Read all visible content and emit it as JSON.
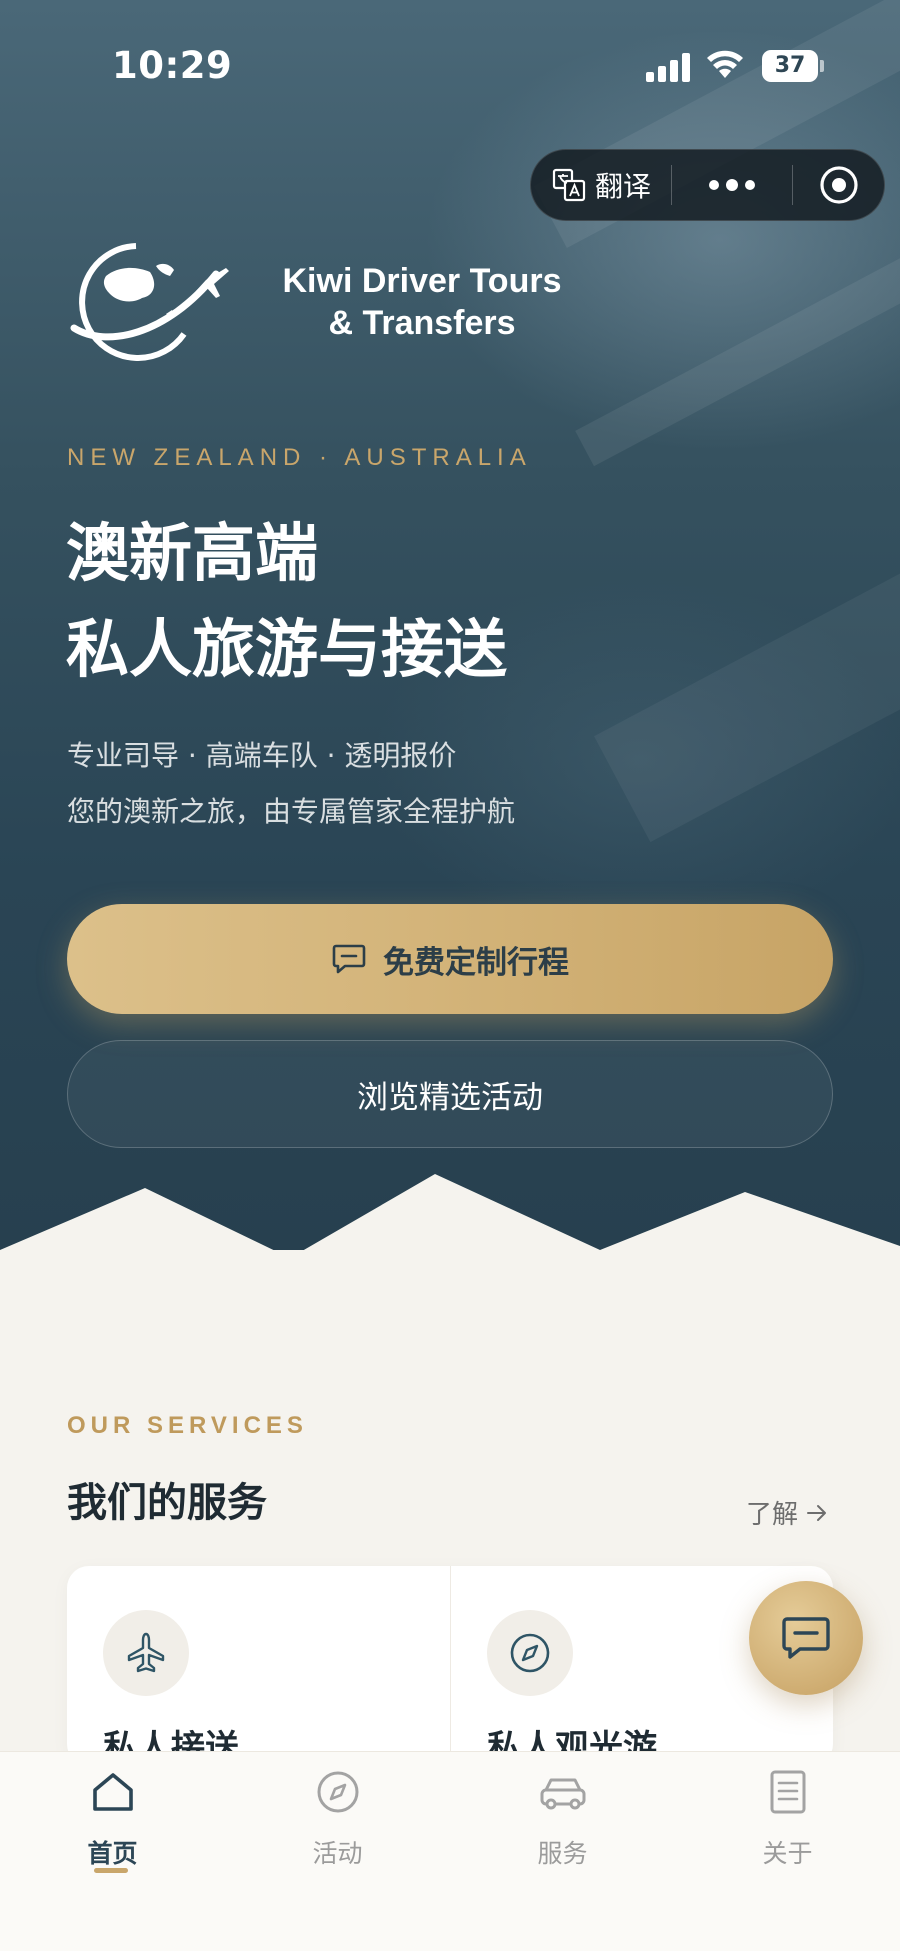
{
  "status_bar": {
    "time": "10:29",
    "battery": "37"
  },
  "capsule": {
    "translate_label": "翻译"
  },
  "brand": {
    "line1": "Kiwi Driver Tours",
    "line2": "& Transfers"
  },
  "hero": {
    "eyebrow": "NEW ZEALAND · AUSTRALIA",
    "headline_line1": "澳新高端",
    "headline_line2": "私人旅游与接送",
    "sub_line1": "专业司导 · 高端车队 · 透明报价",
    "sub_line2": "您的澳新之旅，由专属管家全程护航",
    "primary_button": "免费定制行程",
    "secondary_button": "浏览精选活动"
  },
  "services": {
    "eyebrow": "OUR SERVICES",
    "title": "我们的服务",
    "more_label": "了解",
    "cards": [
      {
        "label": "私人接送",
        "icon": "airplane-icon"
      },
      {
        "label": "私人观光游",
        "icon": "compass-icon"
      }
    ]
  },
  "tabbar": {
    "items": [
      {
        "label": "首页",
        "icon": "home-icon",
        "active": true
      },
      {
        "label": "活动",
        "icon": "compass-icon",
        "active": false
      },
      {
        "label": "服务",
        "icon": "car-icon",
        "active": false
      },
      {
        "label": "关于",
        "icon": "document-icon",
        "active": false
      }
    ]
  },
  "colors": {
    "hero_bg": "#2f4a59",
    "gold_accent": "#c9a66b",
    "page_bg": "#f5f3ee",
    "active_tab": "#2c4656"
  }
}
